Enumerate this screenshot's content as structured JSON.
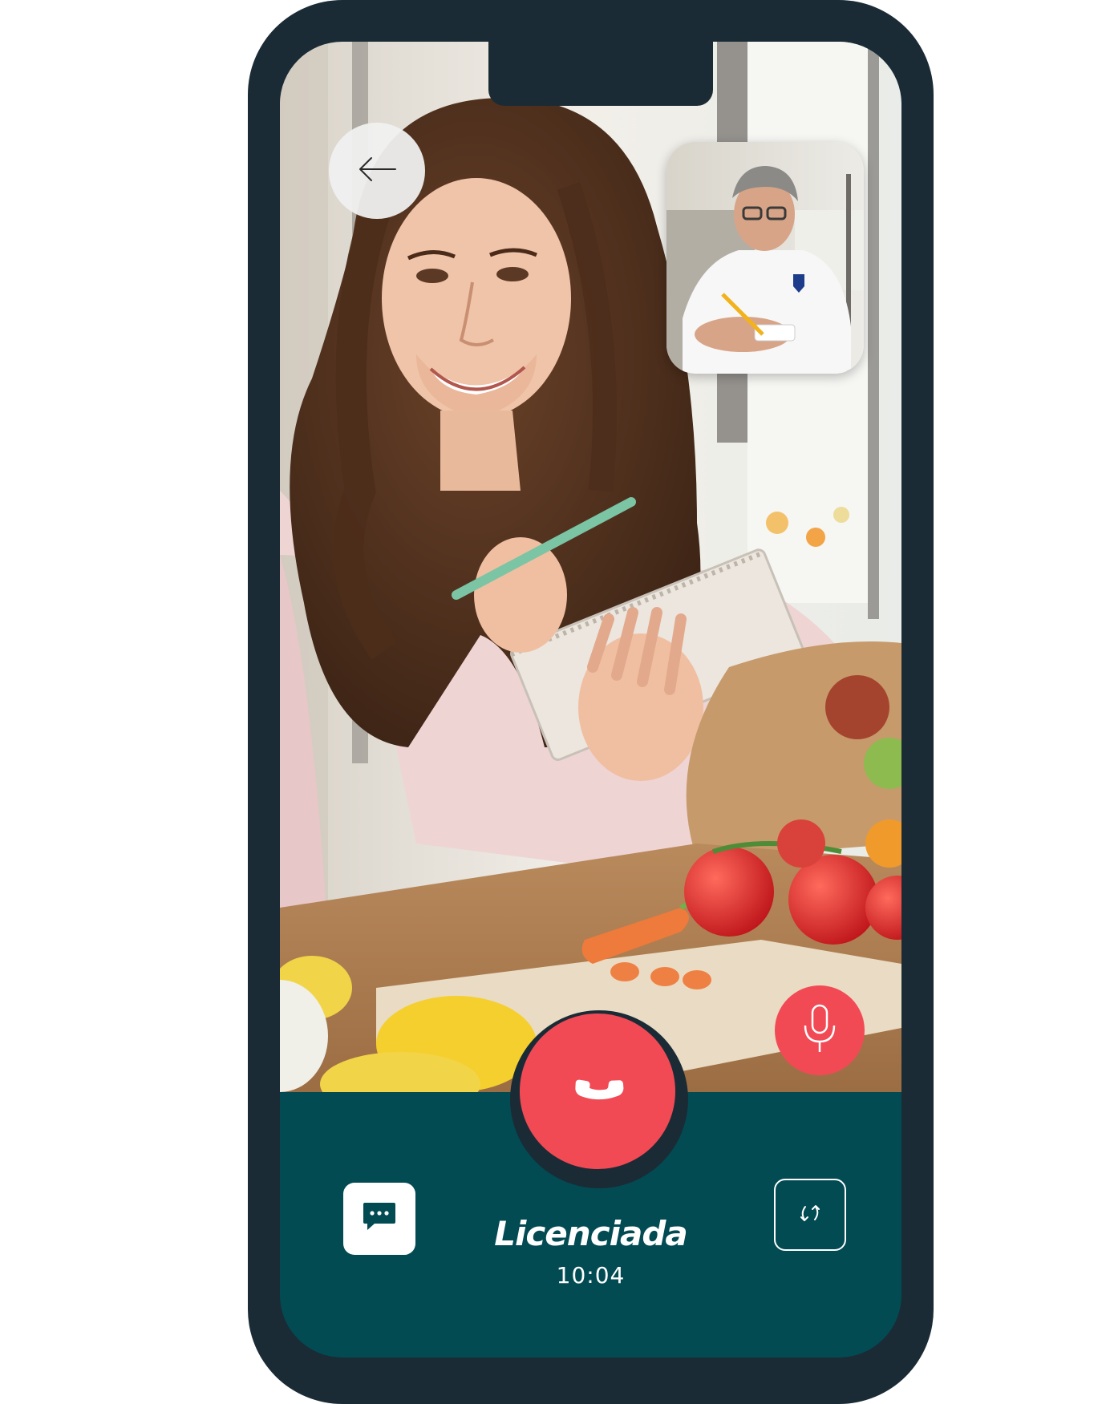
{
  "call": {
    "caller_name": "Licenciada",
    "timer": "10:04"
  },
  "colors": {
    "phone_frame": "#1b2b35",
    "bottom_panel": "#024b53",
    "end_call_red": "#f24a55",
    "icon_white": "#ffffff"
  },
  "icons": {
    "back": "arrow-left-icon",
    "mic": "microphone-icon",
    "end_call": "phone-hangup-icon",
    "chat": "chat-bubble-icon",
    "switch_camera": "camera-switch-icon"
  }
}
